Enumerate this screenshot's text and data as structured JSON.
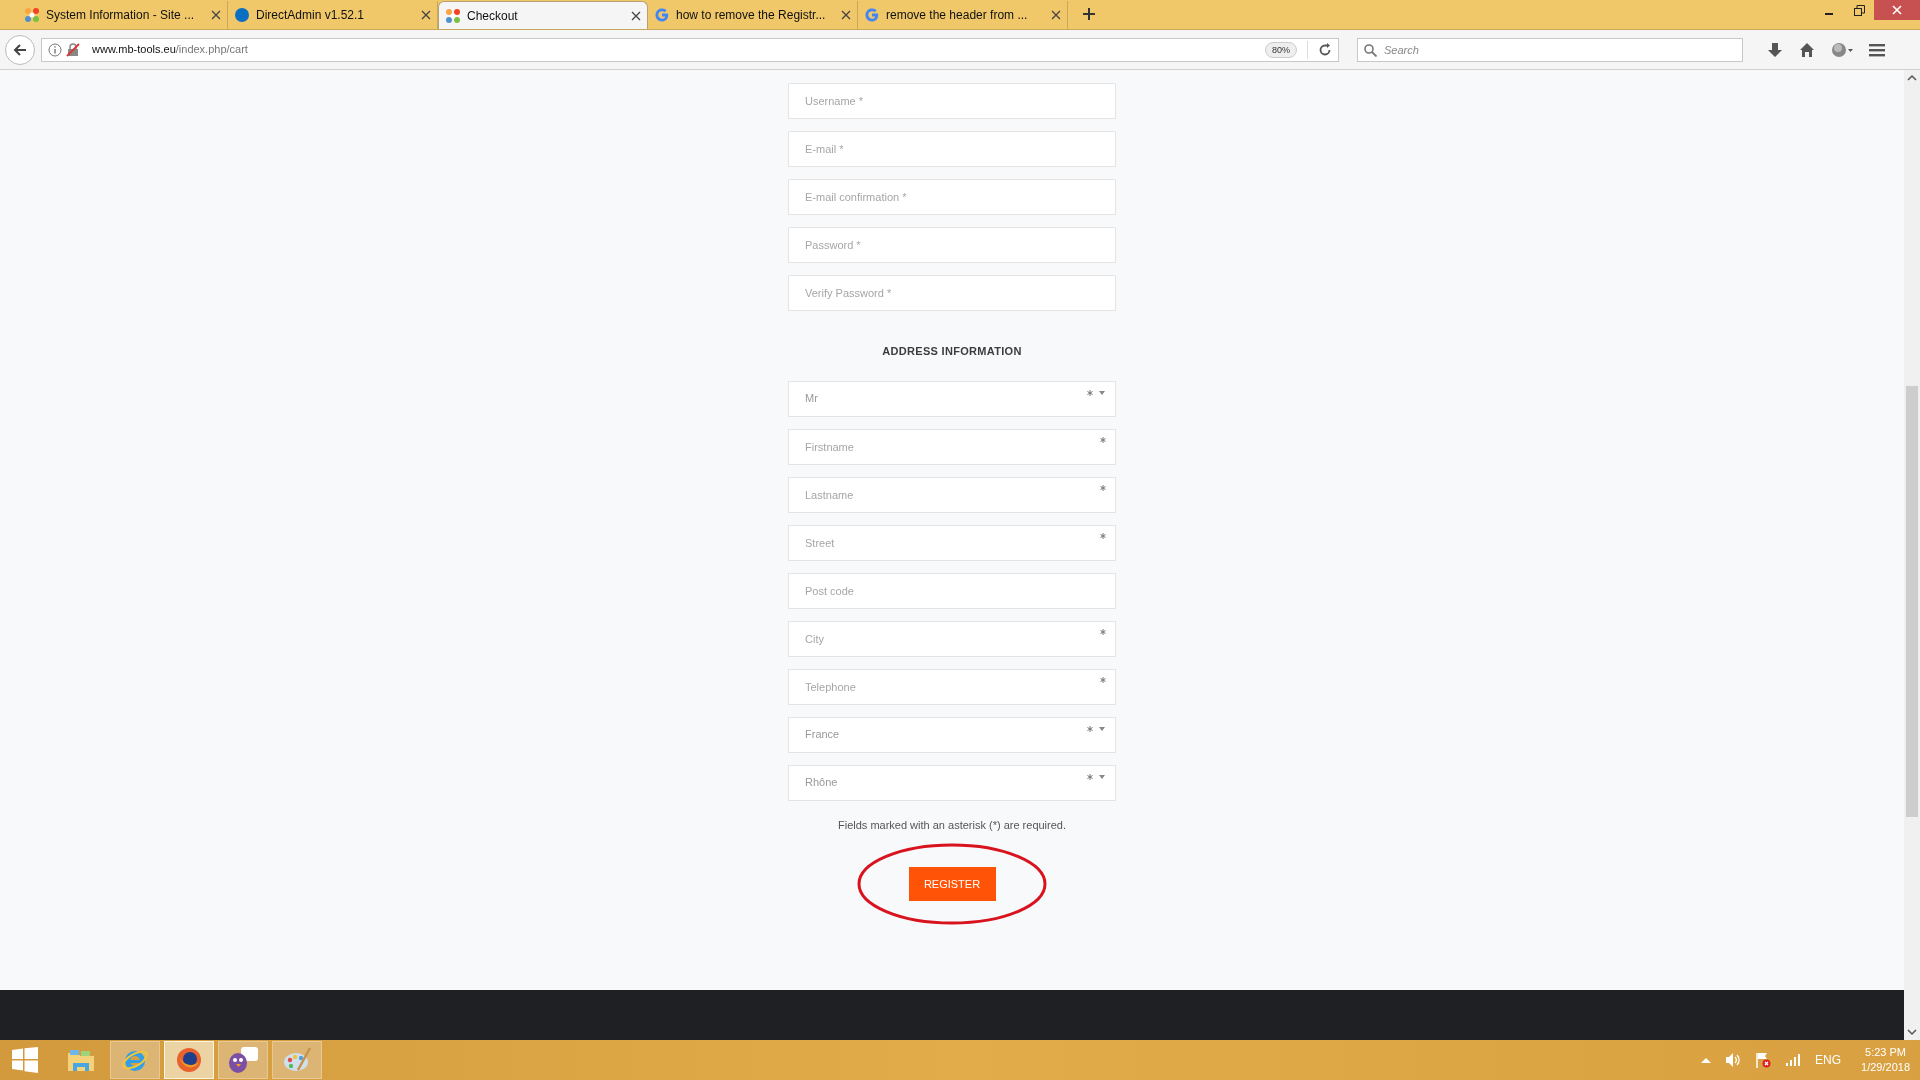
{
  "browser": {
    "tabs": [
      {
        "title": "System Information - Site ...",
        "kind": "joomla",
        "selected": false
      },
      {
        "title": "DirectAdmin v1.52.1",
        "kind": "dot",
        "selected": false
      },
      {
        "title": "Checkout",
        "kind": "joomla",
        "selected": true
      },
      {
        "title": "how to remove the Registr...",
        "kind": "google",
        "selected": false
      },
      {
        "title": "remove the header from ...",
        "kind": "google",
        "selected": false
      }
    ],
    "url": {
      "host": "www.mb-tools.eu",
      "path": "/index.php/cart"
    },
    "zoom": "80%",
    "search": {
      "placeholder": "Search"
    }
  },
  "account_fields": [
    {
      "placeholder": "Username *"
    },
    {
      "placeholder": "E-mail *"
    },
    {
      "placeholder": "E-mail confirmation *"
    },
    {
      "placeholder": "Password *"
    },
    {
      "placeholder": "Verify Password *"
    }
  ],
  "address_heading": "ADDRESS INFORMATION",
  "address_fields": [
    {
      "kind": "select",
      "value": "Mr",
      "required": true
    },
    {
      "kind": "input",
      "placeholder": "Firstname",
      "required": true
    },
    {
      "kind": "input",
      "placeholder": "Lastname",
      "required": true
    },
    {
      "kind": "input",
      "placeholder": "Street",
      "required": true
    },
    {
      "kind": "input",
      "placeholder": "Post code",
      "required": false
    },
    {
      "kind": "input",
      "placeholder": "City",
      "required": true
    },
    {
      "kind": "input",
      "placeholder": "Telephone",
      "required": true
    },
    {
      "kind": "select",
      "value": "France",
      "required": true
    },
    {
      "kind": "select",
      "value": "Rhône",
      "required": true
    }
  ],
  "required_note": "Fields marked with an asterisk (*) are required.",
  "register_button": "REGISTER",
  "taskbar": {
    "apps": [
      {
        "kind": "explorer",
        "selected": false
      },
      {
        "kind": "ie",
        "selected": false
      },
      {
        "kind": "firefox",
        "selected": true
      },
      {
        "kind": "chat",
        "selected": false
      },
      {
        "kind": "paint",
        "selected": false
      }
    ],
    "language": "ENG",
    "time": "5:23 PM",
    "date": "1/29/2018"
  }
}
